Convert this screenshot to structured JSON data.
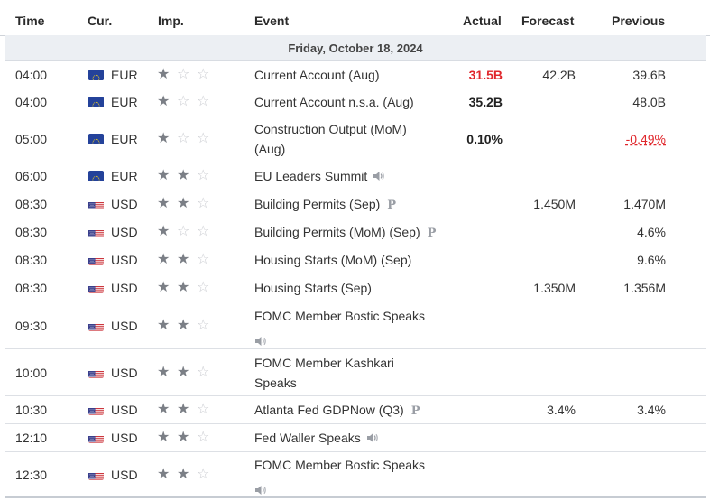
{
  "header": {
    "time": "Time",
    "currency": "Cur.",
    "importance": "Imp.",
    "event": "Event",
    "actual": "Actual",
    "forecast": "Forecast",
    "previous": "Previous"
  },
  "day_label": "Friday, October 18, 2024",
  "colors": {
    "negative": "#e0262b",
    "star_on": "#7b7f86",
    "star_off": "#c9cbd0"
  },
  "rows": [
    {
      "time": "04:00",
      "currency": "EUR",
      "flag": "eu-flag",
      "importance": 1,
      "event": "Current Account (Aug)",
      "icon": "",
      "actual": "31.5B",
      "actual_status": "negative",
      "forecast": "42.2B",
      "previous": "39.6B",
      "previous_status": ""
    },
    {
      "time": "04:00",
      "currency": "EUR",
      "flag": "eu-flag",
      "importance": 1,
      "event": "Current Account n.s.a. (Aug)",
      "icon": "",
      "actual": "35.2B",
      "actual_status": "",
      "forecast": "",
      "previous": "48.0B",
      "previous_status": ""
    },
    {
      "time": "05:00",
      "currency": "EUR",
      "flag": "eu-flag",
      "importance": 1,
      "event": "Construction Output (MoM) (Aug)",
      "icon": "",
      "actual": "0.10%",
      "actual_status": "",
      "forecast": "",
      "previous": "-0.49%",
      "previous_status": "negative"
    },
    {
      "time": "06:00",
      "currency": "EUR",
      "flag": "eu-flag",
      "importance": 2,
      "event": "EU Leaders Summit",
      "icon": "speaker-icon",
      "actual": "",
      "actual_status": "",
      "forecast": "",
      "previous": "",
      "previous_status": ""
    },
    {
      "time": "08:30",
      "currency": "USD",
      "flag": "us-flag",
      "importance": 2,
      "event": "Building Permits (Sep)",
      "icon": "preliminary-icon",
      "actual": "",
      "actual_status": "",
      "forecast": "1.450M",
      "previous": "1.470M",
      "previous_status": ""
    },
    {
      "time": "08:30",
      "currency": "USD",
      "flag": "us-flag",
      "importance": 1,
      "event": "Building Permits (MoM) (Sep)",
      "icon": "preliminary-icon",
      "actual": "",
      "actual_status": "",
      "forecast": "",
      "previous": "4.6%",
      "previous_status": ""
    },
    {
      "time": "08:30",
      "currency": "USD",
      "flag": "us-flag",
      "importance": 2,
      "event": "Housing Starts (MoM) (Sep)",
      "icon": "",
      "actual": "",
      "actual_status": "",
      "forecast": "",
      "previous": "9.6%",
      "previous_status": ""
    },
    {
      "time": "08:30",
      "currency": "USD",
      "flag": "us-flag",
      "importance": 2,
      "event": "Housing Starts (Sep)",
      "icon": "",
      "actual": "",
      "actual_status": "",
      "forecast": "1.350M",
      "previous": "1.356M",
      "previous_status": ""
    },
    {
      "time": "09:30",
      "currency": "USD",
      "flag": "us-flag",
      "importance": 2,
      "event": "FOMC Member Bostic Speaks",
      "icon": "speaker-icon",
      "actual": "",
      "actual_status": "",
      "forecast": "",
      "previous": "",
      "previous_status": ""
    },
    {
      "time": "10:00",
      "currency": "USD",
      "flag": "us-flag",
      "importance": 2,
      "event": "FOMC Member Kashkari Speaks",
      "icon": "speaker-icon",
      "actual": "",
      "actual_status": "",
      "forecast": "",
      "previous": "",
      "previous_status": ""
    },
    {
      "time": "10:30",
      "currency": "USD",
      "flag": "us-flag",
      "importance": 2,
      "event": "Atlanta Fed GDPNow (Q3)",
      "icon": "preliminary-icon",
      "actual": "",
      "actual_status": "",
      "forecast": "3.4%",
      "previous": "3.4%",
      "previous_status": ""
    },
    {
      "time": "12:10",
      "currency": "USD",
      "flag": "us-flag",
      "importance": 2,
      "event": "Fed Waller Speaks",
      "icon": "speaker-icon",
      "actual": "",
      "actual_status": "",
      "forecast": "",
      "previous": "",
      "previous_status": ""
    },
    {
      "time": "12:30",
      "currency": "USD",
      "flag": "us-flag",
      "importance": 2,
      "event": "FOMC Member Bostic Speaks",
      "icon": "speaker-icon",
      "actual": "",
      "actual_status": "",
      "forecast": "",
      "previous": "",
      "previous_status": ""
    }
  ]
}
